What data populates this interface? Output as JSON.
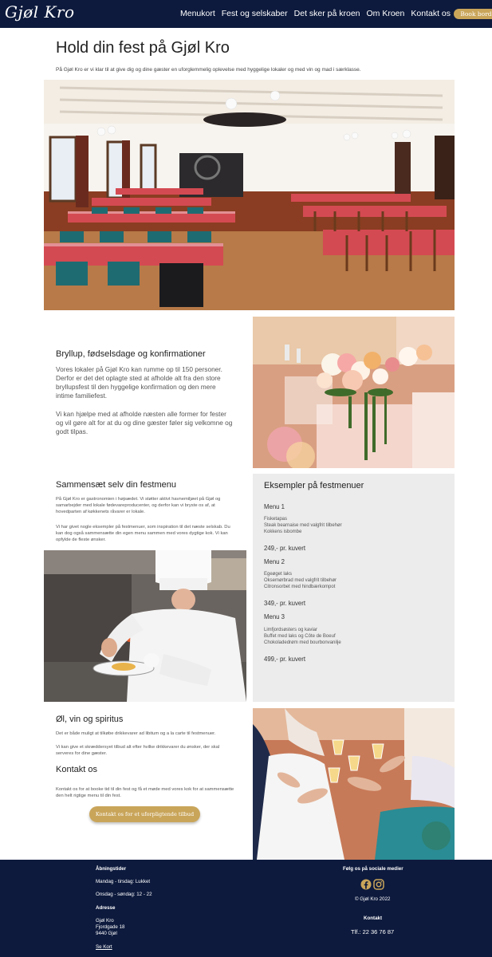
{
  "header": {
    "logo": "Gjøl Kro",
    "nav": [
      "Menukort",
      "Fest og selskaber",
      "Det sker på kroen",
      "Om Kroen",
      "Kontakt os"
    ],
    "book_button": "Book bord"
  },
  "hero": {
    "title": "Hold din fest på Gjøl Kro",
    "intro": "På Gjøl Kro er vi klar til at give dig og dine gæster en uforglemmelig oplevelse med hyggelige lokaler og med vin og mad i særklasse."
  },
  "weddings": {
    "title": "Bryllup, fødselsdage og konfirmationer",
    "p1": "Vores lokaler på Gjøl Kro kan rumme op til 150 personer. Derfor er det det oplagte sted at afholde alt fra den store bryllupsfest til den hyggelige konfirmation og den mere intime familiefest.",
    "p2": "Vi kan hjælpe med at afholde næsten alle former for fester og vil gøre alt for at du og dine gæster føler sig velkomne og godt tilpas."
  },
  "menu_section": {
    "title": "Sammensæt selv din festmenu",
    "p1": "På Gjøl Kro er gastronomien i højsædet. Vi støtter aktivt havnemiljøet på Gjøl og samarbejder med lokale fødevareproducenter, og derfor kan vi bryste os af, at hovedparten af køkkenets råvarer er lokale.",
    "p2": "Vi har givet nogle eksempler på festmenuer, som inspiration til det næste selskab. Du kan dog også sammensætte din egen menu sammen med vores dygtige kok. Vi kan opfylde de fleste ønsker."
  },
  "examples": {
    "title": "Eksempler på festmenuer",
    "menus": [
      {
        "name": "Menu 1",
        "items": [
          "Fisketapas",
          "Steak bearnaise med valgfrit tilbehør",
          "Kokkens isbombe"
        ],
        "price": "249,- pr. kuvert"
      },
      {
        "name": "Menu 2",
        "items": [
          "Egeøget laks",
          "Oksemørbrad med valgfrit tilbehør",
          "Citronsorbet med hindbærkompot"
        ],
        "price": "349,- pr. kuvert"
      },
      {
        "name": "Menu 3",
        "items": [
          "Limfjordsøsters og kaviar",
          "Buffet med laks og Côte de Boeuf",
          "Chokoladedrøm med bourbonvanilje"
        ],
        "price": "499,- pr. kuvert"
      }
    ]
  },
  "drinks": {
    "title": "Øl, vin og spiritus",
    "p1": "Det er både muligt at tilkøbe drikkevarer ad libitum og a la carte til festmenuer.",
    "p2": "Vi kan give et skræddersyet tilbud alt efter hvilke drikkevarer du ønsker, der skal serveres for dine gæster."
  },
  "contact": {
    "title": "Kontakt os",
    "p": "Kontakt os for at booke tid til din fest og få et møde med vores kok for at sammensætte den helt rigtige menu til din fest.",
    "button": "Kontakt os for et uforpligtende tilbud"
  },
  "footer": {
    "hours_label": "Åbningstider",
    "hours_1": "Mandag - tirsdag: Lukket",
    "hours_2": "Onsdag - søndag: 12 - 22",
    "address_label": "Adresse",
    "address_1": "Gjøl Kro",
    "address_2": "Fjordgade 18",
    "address_3": "9440 Gjøl",
    "map_link": "Se Kort",
    "social_label": "Følg os på sociale medier",
    "copyright": "© Gjøl Kro 2022",
    "contact_label": "Kontakt",
    "phone": "Tlf.: 22 36 76 87",
    "icons": [
      "facebook-icon",
      "instagram-icon"
    ]
  },
  "colors": {
    "navy": "#0d1a3d",
    "gold": "#c9a55a",
    "panel": "#ececec"
  }
}
